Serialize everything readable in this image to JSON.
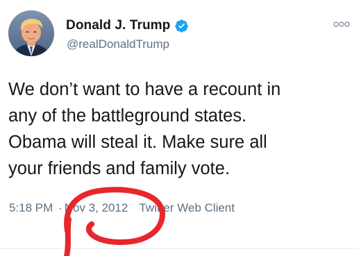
{
  "tweet": {
    "display_name": "Donald J. Trump",
    "handle": "@realDonaldTrump",
    "text": "We don’t want to have a recount in\nany of the battleground states.\nObama will steal it. Make sure all\nyour friends and family vote.",
    "time": "5:18 PM",
    "separator": "·",
    "date": "Nov 3, 2012",
    "client": "Twitter Web Client"
  },
  "icons": {
    "verified": "verified-badge-icon",
    "more": "more-options-icon",
    "avatar": "profile-photo"
  },
  "colors": {
    "verified_blue": "#1da1f2",
    "secondary_text": "#5b7083",
    "primary_text": "#14171a",
    "markup_red": "#e8262b"
  }
}
